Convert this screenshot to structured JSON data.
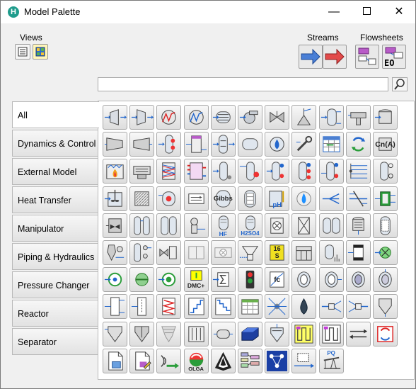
{
  "window": {
    "title": "Model Palette",
    "app_icon_letter": "H",
    "controls": {
      "minimize": "—",
      "close": "✕"
    }
  },
  "views": {
    "label": "Views",
    "buttons": [
      "list-view-icon",
      "grid-view-icon"
    ]
  },
  "streams": {
    "label": "Streams",
    "buttons": [
      "material-stream-icon",
      "energy-stream-icon"
    ]
  },
  "flowsheets": {
    "label": "Flowsheets",
    "buttons": [
      "subflowsheet-icon",
      "eo-subflowsheet-icon"
    ],
    "eo_text": "EO"
  },
  "search": {
    "value": "",
    "placeholder": ""
  },
  "categories": [
    {
      "label": "All",
      "active": true
    },
    {
      "label": "Dynamics & Control",
      "active": false
    },
    {
      "label": "External Model",
      "active": false
    },
    {
      "label": "Heat Transfer",
      "active": false
    },
    {
      "label": "Manipulator",
      "active": false
    },
    {
      "label": "Piping & Hydraulics",
      "active": false
    },
    {
      "label": "Pressure Changer",
      "active": false
    },
    {
      "label": "Reactor",
      "active": false
    },
    {
      "label": "Separator",
      "active": false
    }
  ],
  "palette_rows": [
    [
      "expander-icon",
      "compressor-icon",
      "heater-icon",
      "cooler-icon",
      "shell-tube-exchanger-icon",
      "pump-icon",
      "valve-icon",
      "relief-valve-icon",
      "separator-icon",
      "tee-icon",
      "tank-icon"
    ],
    [
      "compressor-trapezoid-icon",
      "expander-trapezoid-icon",
      "column-feed-icon",
      "tray-section-icon",
      "column-icon",
      "reactor-vessel-icon",
      "burner-icon",
      "wrench-icon",
      "spreadsheet-icon",
      "recycle-icon",
      "cn-a-icon"
    ],
    [
      "fired-heater-icon",
      "cooler-fan-icon",
      "plate-exchanger-icon",
      "lng-exchanger-icon",
      "column-pump-icon",
      "reboiled-absorber-icon",
      "distillation-column-icon",
      "three-phase-column-icon",
      "refluxed-absorber-icon",
      "manifold-icon",
      "column-condenser-icon"
    ],
    [
      "mixer-reactor-icon",
      "pfr-icon",
      "reactor-sequence-icon",
      "pipe-segment-icon",
      "gibbs-reactor-icon",
      "equilibrium-reactor-icon",
      "ph-control-icon",
      "drop-icon",
      "splitter-icon",
      "balance-icon",
      "component-splitter-icon"
    ],
    [
      "compressor-unit-icon",
      "column-train-icon",
      "double-column-icon",
      "pipe-fitting-icon",
      "hf-acid-icon",
      "h2so4-acid-icon",
      "cross-reactor-icon",
      "packed-bed-icon",
      "dual-tank-icon",
      "coalescer-icon",
      "packed-column-icon"
    ],
    [
      "crusher-icon",
      "cascade-column-icon",
      "valve-train-icon",
      "grey-valve-icon",
      "boiler-grey-icon",
      "hopper-icon",
      "sixteen-s-icon",
      "flow-tank-icon",
      "bar-separator-icon",
      "column-chart-icon",
      "green-cross-icon"
    ],
    [
      "controller-circle-icon",
      "flow-circle-icon",
      "dual-circle-icon",
      "dmc-plus-icon",
      "sigma-box-icon",
      "signal-light-icon",
      "fc-curve-icon",
      "filter-left-icon",
      "filter-right-icon",
      "cyclone-icon",
      "hydrocyclone-icon"
    ],
    [
      "tall-column-icon",
      "dotted-column-icon",
      "red-coil-icon",
      "staircase-icon",
      "diagonal-icon",
      "spreadsheet-green-icon",
      "node-star-icon",
      "blue-drop-icon",
      "split-flow-icon",
      "merge-flow-icon",
      "funnel-icon"
    ],
    [
      "cone-filter-icon",
      "cone-mixer-icon",
      "cone-grey-icon",
      "filter-bank-icon",
      "cylinder-icon",
      "blue-box-icon",
      "crystallizer-icon",
      "snake-yellow-icon",
      "snake-white-icon",
      "exchange-arrows-icon",
      "recycle-red-icon"
    ],
    [
      "document-icon",
      "document-edit-icon",
      "signal-arrow-icon",
      "olga-icon",
      "shield-icon",
      "flowchart-icon",
      "network-icon",
      "dotted-block-icon",
      "pq-pumpjack-icon"
    ]
  ],
  "tile_texts": {
    "cn_a": "Cn(A)",
    "gibbs": "Gibbs",
    "ph": "pH",
    "hf": "HF",
    "h2so4": "H2SO4",
    "sixteen_s_top": "16",
    "sixteen_s_bottom": "S",
    "dmc": "DMC+",
    "fc": "fc",
    "olga": "OLGA",
    "pq": "PQ"
  },
  "colors": {
    "arrow_blue": "#2266cc",
    "panel_border": "#b9b9b9",
    "accent_teal": "#1f9c8c"
  }
}
